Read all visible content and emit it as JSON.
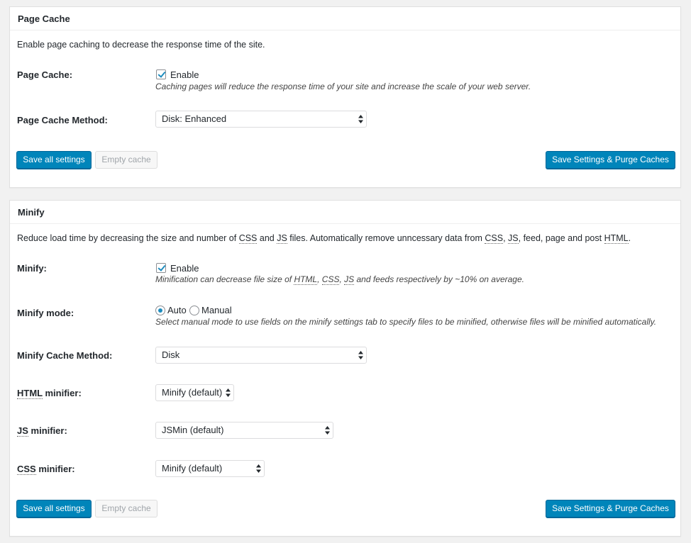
{
  "page_cache": {
    "title": "Page Cache",
    "description": "Enable page caching to decrease the response time of the site.",
    "enable_row": {
      "label": "Page Cache:",
      "checkbox_label": "Enable",
      "checked": true,
      "help": "Caching pages will reduce the response time of your site and increase the scale of your web server."
    },
    "method_row": {
      "label": "Page Cache Method:",
      "selected": "Disk: Enhanced"
    },
    "buttons": {
      "save_all": "Save all settings",
      "empty_cache": "Empty cache",
      "save_purge": "Save Settings & Purge Caches"
    }
  },
  "minify": {
    "title": "Minify",
    "description": {
      "t1": "Reduce load time by decreasing the size and number of ",
      "abbr1": "CSS",
      "t2": " and ",
      "abbr2": "JS",
      "t3": " files. Automatically remove unncessary data from ",
      "abbr3": "CSS",
      "t4": ", ",
      "abbr4": "JS",
      "t5": ", feed, page and post ",
      "abbr5": "HTML",
      "t6": "."
    },
    "enable_row": {
      "label": "Minify:",
      "checkbox_label": "Enable",
      "checked": true,
      "help": {
        "t1": "Minification can decrease file size of ",
        "abbr1": "HTML",
        "t2": ", ",
        "abbr2": "CSS",
        "t3": ", ",
        "abbr3": "JS",
        "t4": " and feeds respectively by ~10% on average."
      }
    },
    "mode_row": {
      "label": "Minify mode:",
      "options": [
        {
          "label": "Auto",
          "checked": true
        },
        {
          "label": "Manual",
          "checked": false
        }
      ],
      "help": "Select manual mode to use fields on the minify settings tab to specify files to be minified, otherwise files will be minified automatically."
    },
    "cache_method_row": {
      "label": "Minify Cache Method:",
      "selected": "Disk"
    },
    "html_minifier_row": {
      "abbr": "HTML",
      "label_suffix": " minifier:",
      "selected": "Minify (default)"
    },
    "js_minifier_row": {
      "abbr": "JS",
      "label_suffix": " minifier:",
      "selected": "JSMin (default)"
    },
    "css_minifier_row": {
      "abbr": "CSS",
      "label_suffix": " minifier:",
      "selected": "Minify (default)"
    },
    "buttons": {
      "save_all": "Save all settings",
      "empty_cache": "Empty cache",
      "save_purge": "Save Settings & Purge Caches"
    }
  },
  "colors": {
    "primary_button": "#0085ba",
    "checkmark": "#1e8cbe",
    "page_background": "#f1f1f1",
    "panel_background": "#ffffff"
  },
  "icons": {
    "checkbox": "checkmark-icon",
    "select_arrows": "updown-arrows-icon"
  }
}
